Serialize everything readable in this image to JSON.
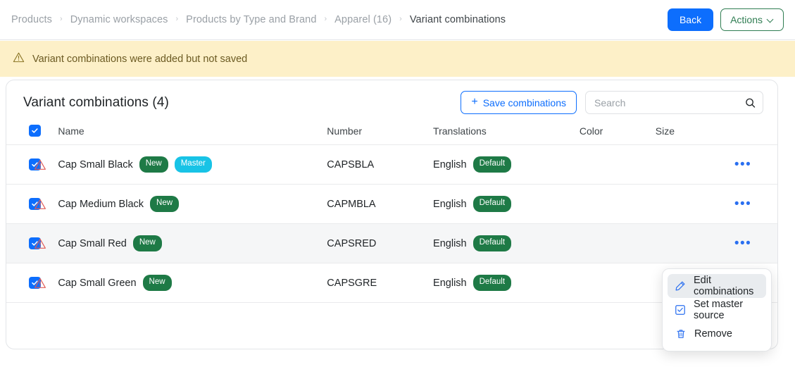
{
  "topbar": {
    "breadcrumb": [
      {
        "label": "Products"
      },
      {
        "label": "Dynamic workspaces"
      },
      {
        "label": "Products by Type and Brand"
      },
      {
        "label": "Apparel (16)"
      },
      {
        "label": "Variant combinations"
      }
    ],
    "separator": "›",
    "back_label": "Back",
    "actions_label": "Actions"
  },
  "banner": {
    "icon": "warning-triangle-icon",
    "text": "Variant combinations were added but not saved"
  },
  "card": {
    "title": "Variant combinations (4)",
    "save_label": "Save combinations",
    "save_icon": "plus-icon",
    "search": {
      "value": "",
      "placeholder": "Search",
      "icon": "search-icon"
    }
  },
  "table": {
    "header_checkbox_checked": true,
    "columns": [
      "Name",
      "Number",
      "Translations",
      "Color",
      "Size"
    ],
    "rows": [
      {
        "checked": true,
        "warning": true,
        "name": "Cap Small Black",
        "badges": [
          {
            "label": "New",
            "kind": "new"
          },
          {
            "label": "Master",
            "kind": "master"
          }
        ],
        "number": "CAPSBLA",
        "translation": "English",
        "translation_badge": "Default",
        "color": "",
        "size": "",
        "highlighted": false
      },
      {
        "checked": true,
        "warning": true,
        "name": "Cap Medium Black",
        "badges": [
          {
            "label": "New",
            "kind": "new"
          }
        ],
        "number": "CAPMBLA",
        "translation": "English",
        "translation_badge": "Default",
        "color": "",
        "size": "",
        "highlighted": false
      },
      {
        "checked": true,
        "warning": true,
        "name": "Cap Small Red",
        "badges": [
          {
            "label": "New",
            "kind": "new"
          }
        ],
        "number": "CAPSRED",
        "translation": "English",
        "translation_badge": "Default",
        "color": "",
        "size": "",
        "highlighted": true
      },
      {
        "checked": true,
        "warning": true,
        "name": "Cap Small Green",
        "badges": [
          {
            "label": "New",
            "kind": "new"
          }
        ],
        "number": "CAPSGRE",
        "translation": "English",
        "translation_badge": "Default",
        "color": "",
        "size": "",
        "highlighted": false
      }
    ],
    "row_menu_icon": "ellipsis-icon"
  },
  "context_menu": {
    "items": [
      {
        "label": "Edit combinations",
        "icon": "pencil-icon",
        "active": true
      },
      {
        "label": "Set master source",
        "icon": "checkbox-icon",
        "active": false
      },
      {
        "label": "Remove",
        "icon": "trash-icon",
        "active": false
      }
    ]
  },
  "colors": {
    "primary_blue": "#0d6efd",
    "green_outline": "#2f7d52",
    "badge_green": "#1e7a46",
    "badge_cyan": "#18c3e6",
    "banner_bg": "#fdf0c8",
    "warning_red": "#d9534f",
    "row_highlight": "#f5f6f7"
  }
}
